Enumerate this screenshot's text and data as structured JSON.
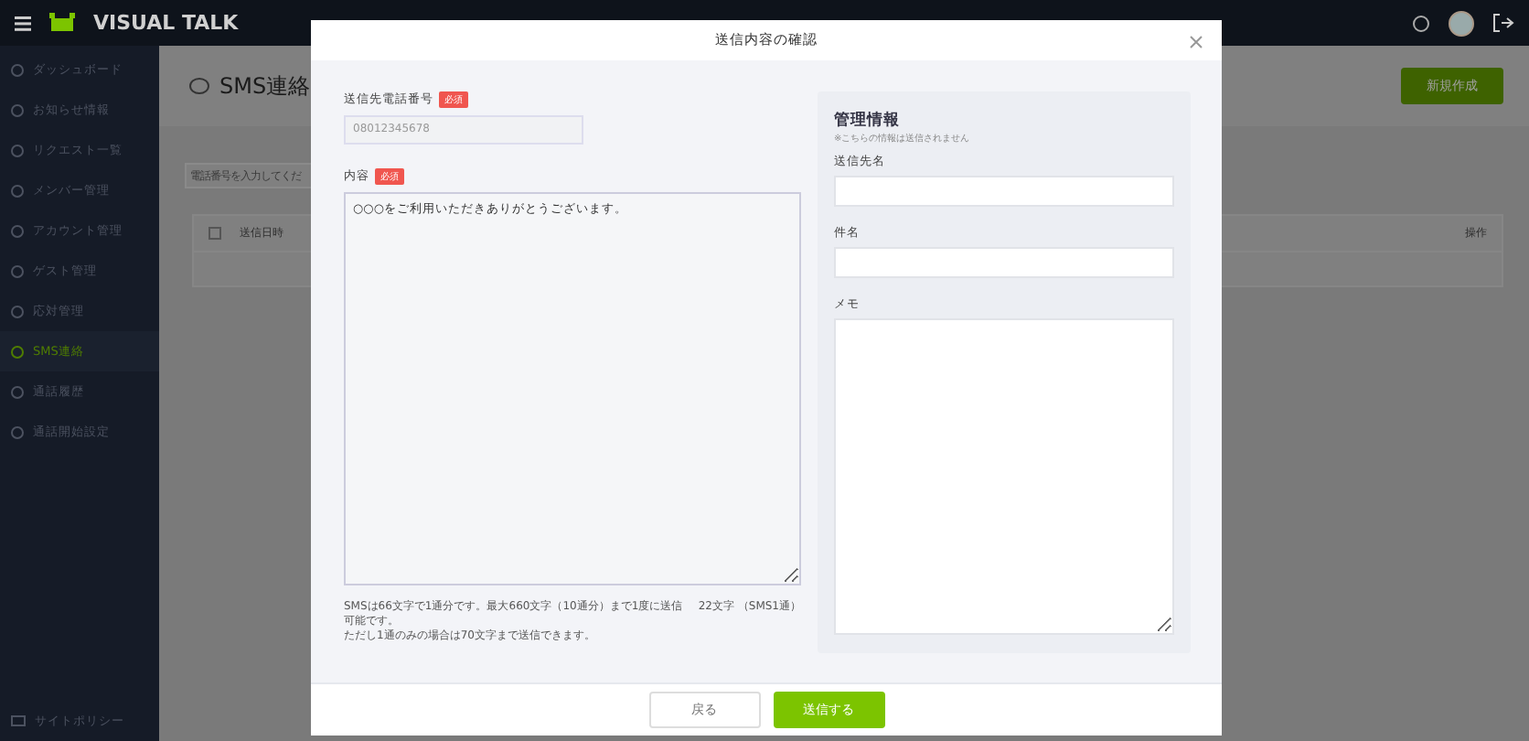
{
  "header": {
    "logo": "VISUAL TALK"
  },
  "sidebar": {
    "items": [
      {
        "label": "ダッシュボード",
        "selected": false
      },
      {
        "label": "お知らせ情報",
        "selected": false
      },
      {
        "label": "リクエスト一覧",
        "selected": false
      },
      {
        "label": "メンバー管理",
        "selected": false
      },
      {
        "label": "アカウント管理",
        "selected": false
      },
      {
        "label": "ゲスト管理",
        "selected": false
      },
      {
        "label": "応対管理",
        "selected": false
      },
      {
        "label": "SMS連絡",
        "selected": true
      },
      {
        "label": "通話履歴",
        "selected": false
      },
      {
        "label": "通話開始設定",
        "selected": false
      }
    ],
    "footer_item": "サイトポリシー"
  },
  "page": {
    "title": "SMS連絡",
    "new_button": "新規作成",
    "search": {
      "placeholder": "電話番号を入力してくだ"
    },
    "table": {
      "select_all_checked": false,
      "columns": [
        "送信日時",
        "操作"
      ]
    }
  },
  "dialog": {
    "title": "送信内容の確認",
    "phone": {
      "label": "送信先電話番号",
      "badge": "必須",
      "value": "08012345678"
    },
    "content": {
      "label": "内容",
      "badge": "必須",
      "value": "○○○をご利用いただきありがとうございます。"
    },
    "notes": [
      "SMSは66文字で1通分です。最大660文字（10通分）まで1度に送信可能です。",
      "ただし1通のみの場合は70文字まで送信できます。"
    ],
    "count": "22文字 （SMS1通）",
    "admin": {
      "title": "管理情報",
      "note": "※こちらの情報は送信されません",
      "fields": [
        {
          "label": "送信先名",
          "kind": "input"
        },
        {
          "label": "件名",
          "kind": "input"
        },
        {
          "label": "メモ",
          "kind": "textarea"
        }
      ]
    },
    "buttons": {
      "back": "戻る",
      "send": "送信する"
    }
  }
}
